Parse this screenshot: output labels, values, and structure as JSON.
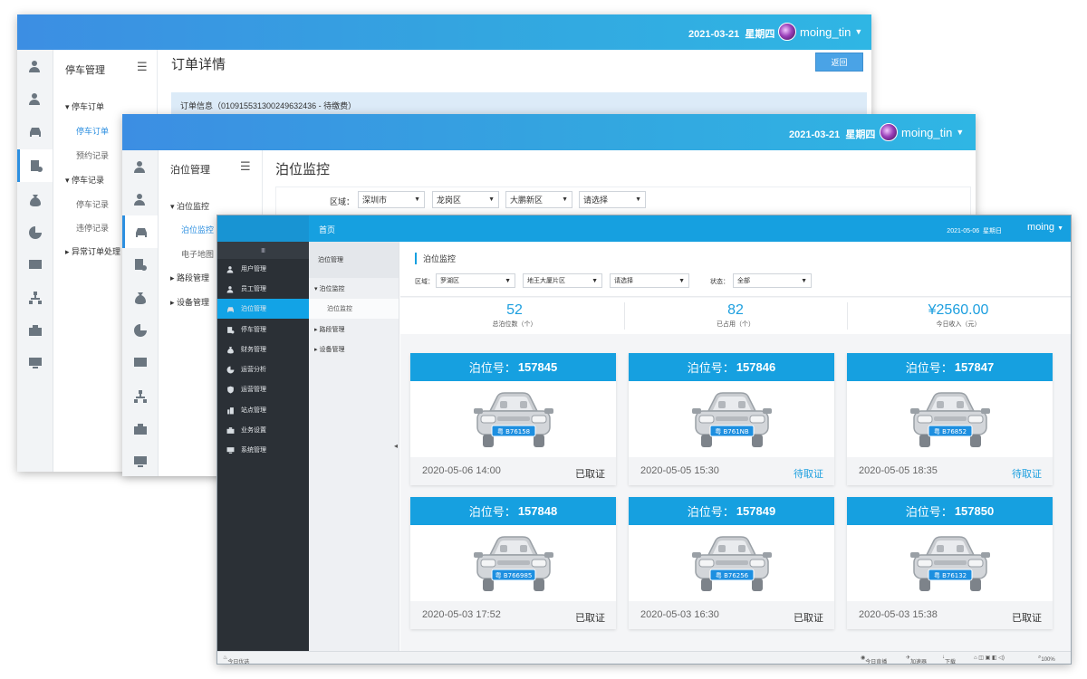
{
  "win1": {
    "date": "2021-03-21",
    "weekday": "星期四",
    "username": "moing_tin",
    "nav_title": "停车管理",
    "page_title": "订单详情",
    "back_button": "返回",
    "info_bar": "订单信息（01091553130024963243​6 - 待缴费）",
    "groups": [
      "停车订单",
      "停车记录",
      "异常订单处理"
    ],
    "items": [
      "停车订单",
      "预约记录",
      "停车记录",
      "违停记录"
    ]
  },
  "win2": {
    "date": "2021-03-21",
    "weekday": "星期四",
    "username": "moing_tin",
    "nav_title": "泊位管理",
    "page_title": "泊位监控",
    "filter_label": "区域：",
    "filters": [
      "深圳市",
      "龙岗区",
      "大鹏新区",
      "请选择"
    ],
    "groups": [
      "泊位监控",
      "路段管理",
      "设备管理"
    ],
    "items": [
      "泊位监控",
      "电子地图"
    ]
  },
  "win3": {
    "home": "首页",
    "date": "2021-05-06",
    "weekday": "星期日",
    "username": "moing",
    "toggle": "Ⅲ",
    "sidebar": [
      "用户管理",
      "员工管理",
      "泊位管理",
      "停车管理",
      "财务管理",
      "运营分析",
      "运营管理",
      "站点管理",
      "业务设置",
      "系统管理"
    ],
    "sub_title": "泊位管理",
    "sub_groups": [
      "泊位监控",
      "路段管理",
      "设备管理"
    ],
    "sub_items": [
      "泊位监控"
    ],
    "section_title": "泊位监控",
    "area_label": "区域：",
    "area_values": [
      "罗湖区",
      "地王大厦片区",
      "请选择"
    ],
    "status_label": "状态：",
    "status_value": "全部",
    "stats": [
      {
        "value": "52",
        "label": "总泊位数（个）"
      },
      {
        "value": "82",
        "label": "已占用（个）"
      },
      {
        "value": "¥2560.00",
        "label": "今日收入（元）"
      }
    ],
    "berth_prefix": "泊位号：",
    "cards": [
      {
        "no": "157845",
        "plate": "粤 B76158",
        "time": "2020-05-06 14:00",
        "status": "已取证",
        "state": "done"
      },
      {
        "no": "157846",
        "plate": "粤 B761NB",
        "time": "2020-05-05 15:30",
        "status": "待取证",
        "state": "wait"
      },
      {
        "no": "157847",
        "plate": "粤 B76852",
        "time": "2020-05-05 18:35",
        "status": "待取证",
        "state": "wait"
      },
      {
        "no": "157848",
        "plate": "粤 B766985",
        "time": "2020-05-03 17:52",
        "status": "已取证",
        "state": "done"
      },
      {
        "no": "157849",
        "plate": "粤 B76256",
        "time": "2020-05-03 16:30",
        "status": "已取证",
        "state": "done"
      },
      {
        "no": "157850",
        "plate": "粤 B76132",
        "time": "2020-05-03 15:38",
        "status": "已取证",
        "state": "done"
      }
    ],
    "statusbar": {
      "left": "今日优选",
      "live": "今日直播",
      "accel": "加速器",
      "download": "下载",
      "zoom": "100%"
    }
  },
  "colors": {
    "accent": "#16a0e0",
    "topbar": "#3c8ee3",
    "dark_sidebar": "#2b3036",
    "wait_status": "#1d9fdf"
  }
}
